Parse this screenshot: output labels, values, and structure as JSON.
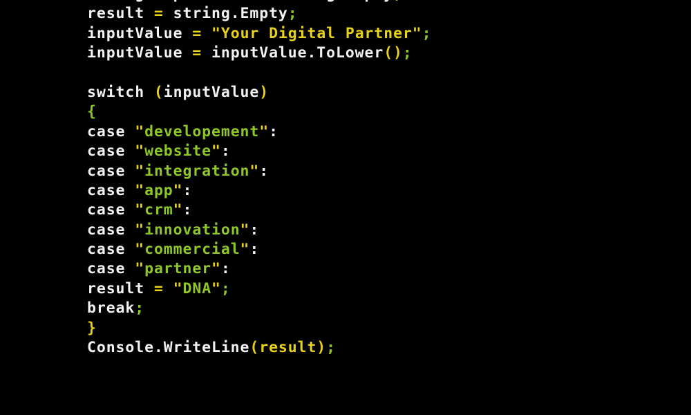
{
  "editor": {
    "background_color": "#000000",
    "language": "csharp",
    "font_size_px": 21.5
  },
  "palette": {
    "plain_text": "#f2f2f2",
    "operator": "#e8d11a",
    "punctuation": "#e8d11a",
    "semicolon": "#8fc728",
    "brace_open": "#8fc728",
    "brace_close": "#e8d11a",
    "string_quote": "#e8d11a",
    "string_green": "#8fc728",
    "string_gold": "#e8d11a",
    "argument_identifier": "#e8d11a",
    "background": "#000000"
  },
  "code": {
    "lines": [
      {
        "id": "line-declare-inputvalue",
        "clipped_top": true,
        "tokens": [
          {
            "text": "string inputValue ",
            "type": "plain"
          },
          {
            "text": "=",
            "type": "op"
          },
          {
            "text": " string.Empty",
            "type": "plain"
          },
          {
            "text": ";",
            "type": "semi"
          }
        ]
      },
      {
        "id": "line-declare-result",
        "tokens": [
          {
            "text": "result ",
            "type": "plain"
          },
          {
            "text": "=",
            "type": "op"
          },
          {
            "text": " string.Empty",
            "type": "plain"
          },
          {
            "text": ";",
            "type": "semi"
          }
        ]
      },
      {
        "id": "line-assign-literal",
        "tokens": [
          {
            "text": "inputValue ",
            "type": "plain"
          },
          {
            "text": "=",
            "type": "op"
          },
          {
            "text": " ",
            "type": "plain"
          },
          {
            "text": "\"",
            "type": "quote"
          },
          {
            "text": "Your Digital Partner",
            "type": "str-gold"
          },
          {
            "text": "\"",
            "type": "quote"
          },
          {
            "text": ";",
            "type": "semi"
          }
        ]
      },
      {
        "id": "line-tolower",
        "tokens": [
          {
            "text": "inputValue ",
            "type": "plain"
          },
          {
            "text": "=",
            "type": "op"
          },
          {
            "text": " inputValue.ToLower",
            "type": "plain"
          },
          {
            "text": "()",
            "type": "punc"
          },
          {
            "text": ";",
            "type": "semi"
          }
        ]
      },
      {
        "id": "line-blank-1",
        "tokens": []
      },
      {
        "id": "line-switch",
        "tokens": [
          {
            "text": "switch ",
            "type": "plain"
          },
          {
            "text": "(",
            "type": "punc"
          },
          {
            "text": "inputValue",
            "type": "plain"
          },
          {
            "text": ")",
            "type": "punc"
          }
        ]
      },
      {
        "id": "line-switch-open-brace",
        "tokens": [
          {
            "text": "{",
            "type": "brace-open"
          }
        ]
      },
      {
        "id": "line-case-developement",
        "tokens": [
          {
            "text": "case ",
            "type": "plain"
          },
          {
            "text": "\"",
            "type": "quote"
          },
          {
            "text": "developement",
            "type": "str-green"
          },
          {
            "text": "\"",
            "type": "quote"
          },
          {
            "text": ":",
            "type": "plain"
          }
        ]
      },
      {
        "id": "line-case-website",
        "tokens": [
          {
            "text": "case ",
            "type": "plain"
          },
          {
            "text": "\"",
            "type": "quote"
          },
          {
            "text": "website",
            "type": "str-green"
          },
          {
            "text": "\"",
            "type": "quote"
          },
          {
            "text": ":",
            "type": "plain"
          }
        ]
      },
      {
        "id": "line-case-integration",
        "tokens": [
          {
            "text": "case ",
            "type": "plain"
          },
          {
            "text": "\"",
            "type": "quote"
          },
          {
            "text": "integration",
            "type": "str-green"
          },
          {
            "text": "\"",
            "type": "quote"
          },
          {
            "text": ":",
            "type": "plain"
          }
        ]
      },
      {
        "id": "line-case-app",
        "tokens": [
          {
            "text": "case ",
            "type": "plain"
          },
          {
            "text": "\"",
            "type": "quote"
          },
          {
            "text": "app",
            "type": "str-green"
          },
          {
            "text": "\"",
            "type": "quote"
          },
          {
            "text": ":",
            "type": "plain"
          }
        ]
      },
      {
        "id": "line-case-crm",
        "tokens": [
          {
            "text": "case ",
            "type": "plain"
          },
          {
            "text": "\"",
            "type": "quote"
          },
          {
            "text": "crm",
            "type": "str-green"
          },
          {
            "text": "\"",
            "type": "quote"
          },
          {
            "text": ":",
            "type": "plain"
          }
        ]
      },
      {
        "id": "line-case-innovation",
        "tokens": [
          {
            "text": "case ",
            "type": "plain"
          },
          {
            "text": "\"",
            "type": "quote"
          },
          {
            "text": "innovation",
            "type": "str-green"
          },
          {
            "text": "\"",
            "type": "quote"
          },
          {
            "text": ":",
            "type": "plain"
          }
        ]
      },
      {
        "id": "line-case-commercial",
        "tokens": [
          {
            "text": "case ",
            "type": "plain"
          },
          {
            "text": "\"",
            "type": "quote"
          },
          {
            "text": "commercial",
            "type": "str-green"
          },
          {
            "text": "\"",
            "type": "quote"
          },
          {
            "text": ":",
            "type": "plain"
          }
        ]
      },
      {
        "id": "line-case-partner",
        "tokens": [
          {
            "text": "case ",
            "type": "plain"
          },
          {
            "text": "\"",
            "type": "quote"
          },
          {
            "text": "partner",
            "type": "str-green"
          },
          {
            "text": "\"",
            "type": "quote"
          },
          {
            "text": ":",
            "type": "plain"
          }
        ]
      },
      {
        "id": "line-result-dna",
        "tokens": [
          {
            "text": "result ",
            "type": "plain"
          },
          {
            "text": "=",
            "type": "op"
          },
          {
            "text": " ",
            "type": "plain"
          },
          {
            "text": "\"",
            "type": "quote"
          },
          {
            "text": "DNA",
            "type": "str-green"
          },
          {
            "text": "\"",
            "type": "quote"
          },
          {
            "text": ";",
            "type": "semi"
          }
        ]
      },
      {
        "id": "line-break",
        "tokens": [
          {
            "text": "break",
            "type": "plain"
          },
          {
            "text": ";",
            "type": "semi"
          }
        ]
      },
      {
        "id": "line-switch-close-brace",
        "tokens": [
          {
            "text": "}",
            "type": "brace-close"
          }
        ]
      },
      {
        "id": "line-console-writeline",
        "tokens": [
          {
            "text": "Console.WriteLine",
            "type": "plain"
          },
          {
            "text": "(",
            "type": "punc"
          },
          {
            "text": "result",
            "type": "ident-arg"
          },
          {
            "text": ")",
            "type": "punc"
          },
          {
            "text": ";",
            "type": "semi"
          }
        ]
      }
    ]
  }
}
